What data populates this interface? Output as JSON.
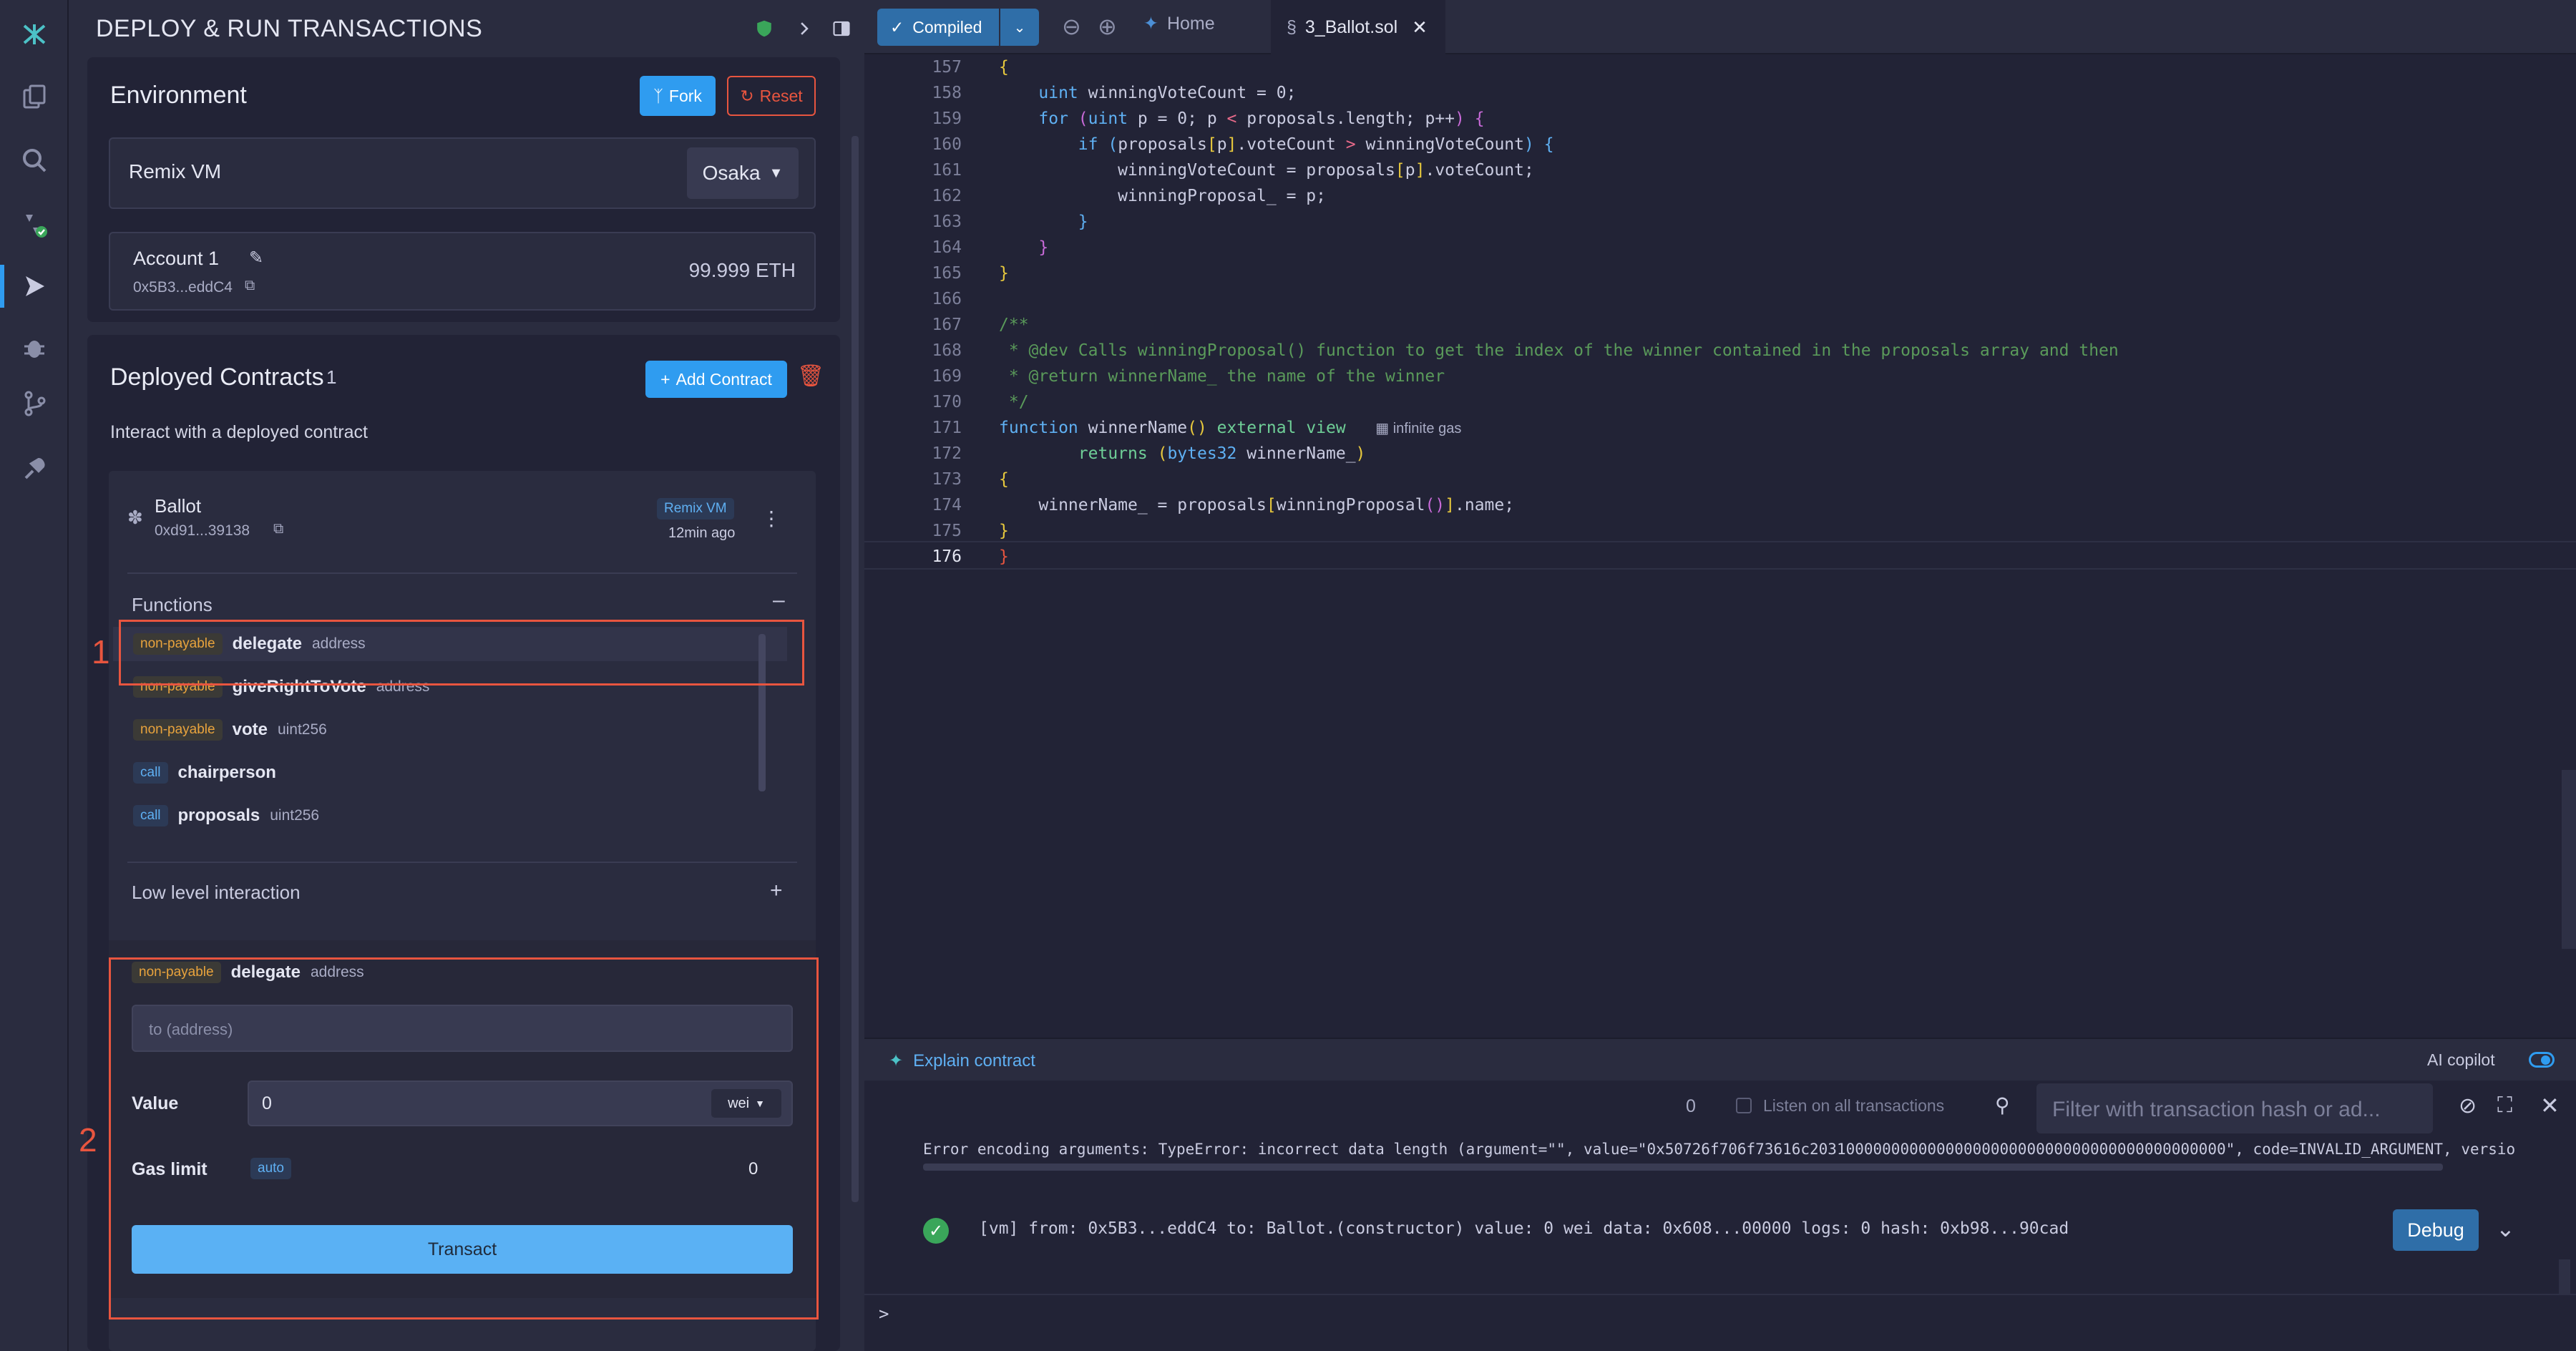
{
  "sidebar": {
    "icons": [
      "remix-logo-icon",
      "file-explorer-icon",
      "search-icon",
      "solidity-compiler-icon",
      "deploy-run-icon",
      "debugger-icon",
      "git-icon",
      "plugin-manager-icon"
    ]
  },
  "panel": {
    "title": "DEPLOY & RUN TRANSACTIONS",
    "environment": {
      "heading": "Environment",
      "fork_label": "Fork",
      "reset_label": "Reset",
      "provider": "Remix VM",
      "fork_version": "Osaka",
      "account_name": "Account 1",
      "account_address": "0x5B3...eddC4",
      "balance": "99.999 ETH"
    },
    "deployed": {
      "heading": "Deployed Contracts",
      "count": "1",
      "add_contract_label": "Add Contract",
      "subtitle": "Interact with a deployed contract",
      "contract_name": "Ballot",
      "contract_address": "0xd91...39138",
      "vm_badge": "Remix VM",
      "age": "12min ago",
      "functions_heading": "Functions",
      "functions": [
        {
          "badge": "non-payable",
          "name": "delegate",
          "arg": "address",
          "kind": "np"
        },
        {
          "badge": "non-payable",
          "name": "giveRightToVote",
          "arg": "address",
          "kind": "np"
        },
        {
          "badge": "non-payable",
          "name": "vote",
          "arg": "uint256",
          "kind": "np"
        },
        {
          "badge": "call",
          "name": "chairperson",
          "arg": "",
          "kind": "call"
        },
        {
          "badge": "call",
          "name": "proposals",
          "arg": "uint256",
          "kind": "call"
        }
      ],
      "low_level_label": "Low level interaction",
      "selected_function": {
        "badge": "non-payable",
        "name": "delegate",
        "arg": "address",
        "input_placeholder": "to (address)",
        "value_label": "Value",
        "value": "0",
        "unit": "wei",
        "gas_label": "Gas limit",
        "gas_mode": "auto",
        "gas_value": "0",
        "transact_label": "Transact"
      }
    }
  },
  "tabs": {
    "compiled_label": "Compiled",
    "home_label": "Home",
    "file_label": "3_Ballot.sol"
  },
  "code": {
    "lines": [
      {
        "n": "157",
        "html": "<span style='color:#e8c93d'>{</span>"
      },
      {
        "n": "158",
        "html": "    <span style='color:#5fb0f3'>uint</span> <span style='color:#c9cbe0'>winningVoteCount = 0;</span>"
      },
      {
        "n": "159",
        "html": "    <span style='color:#5fb0f3'>for</span> <span style='color:#c86ad8'>(</span><span style='color:#5fb0f3'>uint</span> p = 0; p <span style='color:#e86a8a'>&lt;</span> proposals.length; p++<span style='color:#c86ad8'>)</span> <span style='color:#c86ad8'>{</span>"
      },
      {
        "n": "160",
        "html": "        <span style='color:#5fb0f3'>if</span> <span style='color:#5fb0f3'>(</span>proposals<span style='color:#e8c93d'>[</span>p<span style='color:#e8c93d'>]</span>.voteCount <span style='color:#e86a8a'>&gt;</span> winningVoteCount<span style='color:#5fb0f3'>)</span> <span style='color:#5fb0f3'>{</span>"
      },
      {
        "n": "161",
        "html": "            winningVoteCount = proposals<span style='color:#e8c93d'>[</span>p<span style='color:#e8c93d'>]</span>.voteCount;"
      },
      {
        "n": "162",
        "html": "            winningProposal_ = p;"
      },
      {
        "n": "163",
        "html": "        <span style='color:#5fb0f3'>}</span>"
      },
      {
        "n": "164",
        "html": "    <span style='color:#c86ad8'>}</span>"
      },
      {
        "n": "165",
        "html": "<span style='color:#e8c93d'>}</span>"
      },
      {
        "n": "166",
        "html": ""
      },
      {
        "n": "167",
        "html": "<span style='color:#5a9a5a'>/**</span>"
      },
      {
        "n": "168",
        "html": "<span style='color:#5a9a5a'> * @dev Calls winningProposal() function to get the index of the winner contained in the proposals array and then</span>"
      },
      {
        "n": "169",
        "html": "<span style='color:#5a9a5a'> * @return winnerName_ the name of the winner</span>"
      },
      {
        "n": "170",
        "html": "<span style='color:#5a9a5a'> */</span>"
      },
      {
        "n": "171",
        "html": "<span style='color:#5fb0f3'>function</span> winnerName<span style='color:#e8c93d'>()</span> <span style='color:#6fcf97'>external</span> <span style='color:#6fcf97'>view</span>   <span style='color:#a9acc5;font-family:Liberation Sans,sans-serif;font-size:20px'>&#9638; infinite gas</span>"
      },
      {
        "n": "172",
        "html": "        <span style='color:#6fcf97'>returns</span> <span style='color:#e8c93d'>(</span><span style='color:#5fb0f3'>bytes32</span> winnerName_<span style='color:#e8c93d'>)</span>"
      },
      {
        "n": "173",
        "html": "<span style='color:#e8c93d'>{</span>"
      },
      {
        "n": "174",
        "html": "    winnerName_ = proposals<span style='color:#e8c93d'>[</span>winningProposal<span style='color:#c86ad8'>()</span><span style='color:#e8c93d'>]</span>.name;"
      },
      {
        "n": "175",
        "html": "<span style='color:#e8c93d'>}</span>"
      },
      {
        "n": "176",
        "html": "<span style='color:#e8553f'>}</span>"
      }
    ]
  },
  "terminal": {
    "explain_label": "Explain contract",
    "ai_copilot_label": "AI copilot",
    "count": "0",
    "listen_label": "Listen on all transactions",
    "filter_placeholder": "Filter with transaction hash or ad...",
    "error_text": "Error encoding arguments: TypeError: incorrect data length (argument=\"\", value=\"0x50726f706f73616c2031000000000000000000000000000000000000000000\", code=INVALID_ARGUMENT, versio",
    "tx_text": "[vm] from: 0x5B3...eddC4 to: Ballot.(constructor) value: 0 wei data: 0x608...00000 logs: 0 hash: 0xb98...90cad",
    "debug_label": "Debug",
    "prompt": ">"
  },
  "annotations": {
    "box1_number": "1",
    "box2_number": "2"
  },
  "colors": {
    "accent": "#2f9cf0",
    "transact": "#5ab1f4",
    "annotation": "#e8553f",
    "nonpayable": "#e8a33d"
  }
}
